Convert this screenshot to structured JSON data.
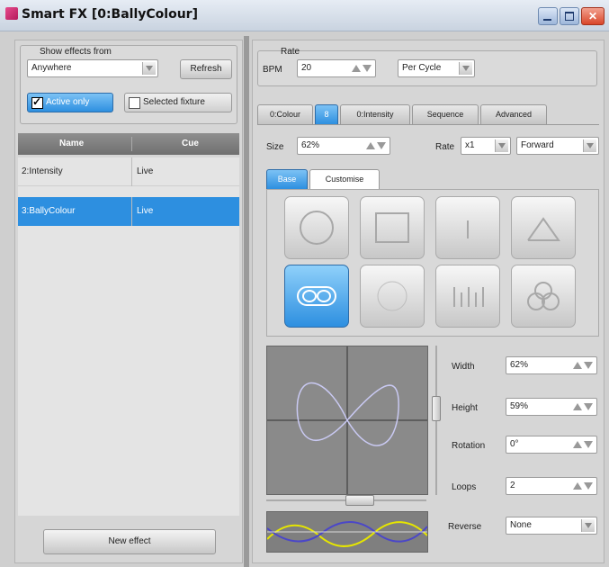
{
  "window": {
    "title": "Smart FX  [0:BallyColour]"
  },
  "left": {
    "show_effects_label": "Show effects from",
    "source": "Anywhere",
    "refresh_label": "Refresh",
    "active_only_label": "Active only",
    "active_only_checked": true,
    "selected_fixture_label": "Selected fixture",
    "selected_fixture_checked": false,
    "columns": [
      "Name",
      "Cue"
    ],
    "rows": [
      {
        "name": "2:Intensity",
        "cue": "Live",
        "selected": false
      },
      {
        "name": "3:BallyColour",
        "cue": "Live",
        "selected": true
      }
    ],
    "new_effect_label": "New effect"
  },
  "right": {
    "rate_group_label": "Rate",
    "bpm_label": "BPM",
    "bpm_value": "20",
    "rate_mode": "Per Cycle",
    "tabs": [
      "0:Colour",
      "8",
      "0:Intensity",
      "Sequence",
      "Advanced"
    ],
    "active_tab": 1,
    "size_label": "Size",
    "size_value": "62%",
    "rate_label": "Rate",
    "rate_value": "x1",
    "direction": "Forward",
    "subtabs": [
      "Base",
      "Customise"
    ],
    "active_subtab": 0,
    "shapes": [
      "circle-shape-icon",
      "square-shape-icon",
      "line-shape-icon",
      "triangle-shape-icon",
      "figure-eight-shape-icon",
      "blank-shape-icon",
      "bally-shape-icon",
      "flower-shape-icon"
    ],
    "selected_shape": 4,
    "params": [
      {
        "label": "Width",
        "value": "62%"
      },
      {
        "label": "Height",
        "value": "59%"
      },
      {
        "label": "Rotation",
        "value": "0°"
      },
      {
        "label": "Loops",
        "value": "2"
      }
    ],
    "reverse_label": "Reverse",
    "reverse_value": "None"
  }
}
